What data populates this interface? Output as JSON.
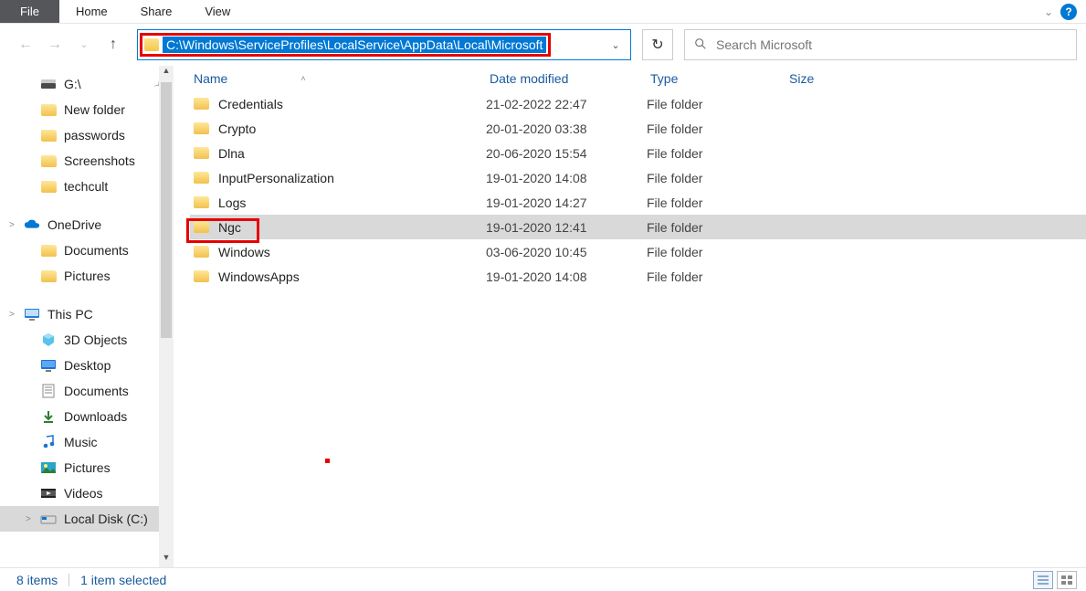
{
  "ribbon": {
    "file": "File",
    "tabs": [
      "Home",
      "Share",
      "View"
    ]
  },
  "nav": {
    "address_path": "C:\\Windows\\ServiceProfiles\\LocalService\\AppData\\Local\\Microsoft",
    "search_placeholder": "Search Microsoft"
  },
  "tree": {
    "top": [
      {
        "label": "G:\\",
        "icon": "drive",
        "pinned": true
      },
      {
        "label": "New folder",
        "icon": "folder"
      },
      {
        "label": "passwords",
        "icon": "folder"
      },
      {
        "label": "Screenshots",
        "icon": "folder"
      },
      {
        "label": "techcult",
        "icon": "folder"
      }
    ],
    "onedrive": {
      "label": "OneDrive",
      "children": [
        {
          "label": "Documents",
          "icon": "folder"
        },
        {
          "label": "Pictures",
          "icon": "folder"
        }
      ]
    },
    "thispc": {
      "label": "This PC",
      "children": [
        {
          "label": "3D Objects",
          "icon": "3d"
        },
        {
          "label": "Desktop",
          "icon": "desktop"
        },
        {
          "label": "Documents",
          "icon": "documents"
        },
        {
          "label": "Downloads",
          "icon": "downloads"
        },
        {
          "label": "Music",
          "icon": "music"
        },
        {
          "label": "Pictures",
          "icon": "pictures"
        },
        {
          "label": "Videos",
          "icon": "videos"
        },
        {
          "label": "Local Disk (C:)",
          "icon": "localdisk",
          "selected": true
        }
      ]
    }
  },
  "columns": {
    "name": "Name",
    "date": "Date modified",
    "type": "Type",
    "size": "Size"
  },
  "rows": [
    {
      "name": "Credentials",
      "date": "21-02-2022 22:47",
      "type": "File folder"
    },
    {
      "name": "Crypto",
      "date": "20-01-2020 03:38",
      "type": "File folder"
    },
    {
      "name": "Dlna",
      "date": "20-06-2020 15:54",
      "type": "File folder"
    },
    {
      "name": "InputPersonalization",
      "date": "19-01-2020 14:08",
      "type": "File folder"
    },
    {
      "name": "Logs",
      "date": "19-01-2020 14:27",
      "type": "File folder"
    },
    {
      "name": "Ngc",
      "date": "19-01-2020 12:41",
      "type": "File folder",
      "selected": true,
      "highlighted": true
    },
    {
      "name": "Windows",
      "date": "03-06-2020 10:45",
      "type": "File folder"
    },
    {
      "name": "WindowsApps",
      "date": "19-01-2020 14:08",
      "type": "File folder"
    }
  ],
  "status": {
    "count": "8 items",
    "selection": "1 item selected"
  }
}
